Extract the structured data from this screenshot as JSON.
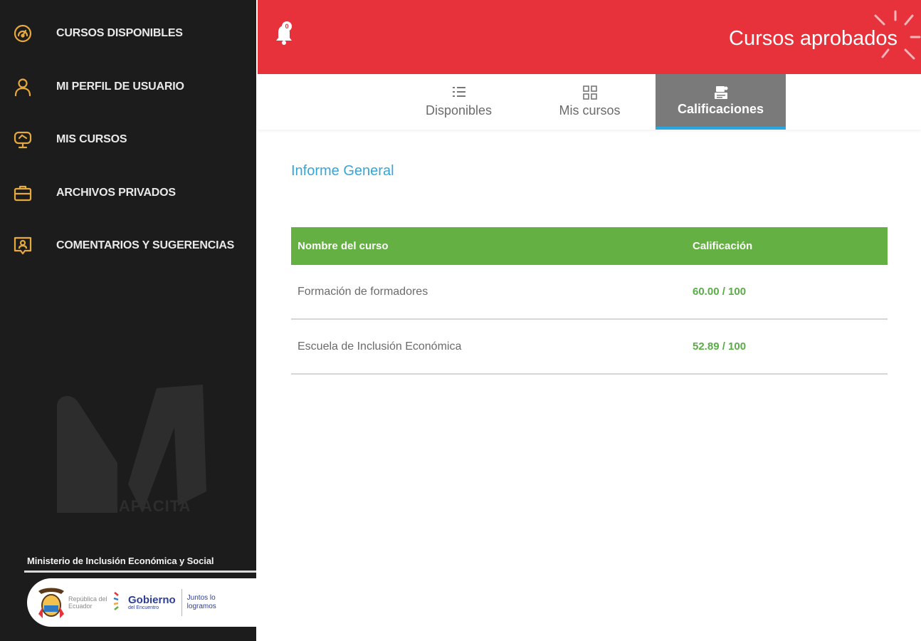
{
  "sidebar": {
    "items": [
      {
        "label": "CURSOS DISPONIBLES",
        "icon": "dashboard-gauge-icon"
      },
      {
        "label": "MI PERFIL DE USUARIO",
        "icon": "user-icon"
      },
      {
        "label": "MIS CURSOS",
        "icon": "monitor-icon"
      },
      {
        "label": "ARCHIVOS PRIVADOS",
        "icon": "briefcase-icon"
      },
      {
        "label": "COMENTARIOS Y SUGERENCIAS",
        "icon": "feedback-icon"
      }
    ],
    "watermark": {
      "logo": "mi-capacita-logo",
      "text": "CAPACITA"
    },
    "ministry": "Ministerio de Inclusión Económica y Social",
    "gov_card": {
      "republica": "República del Ecuador",
      "gobierno": "Gobierno",
      "gobierno_sub": "del Encuentro",
      "juntos": "Juntos lo logramos"
    }
  },
  "header": {
    "title": "Cursos aprobados",
    "notification_count": "0",
    "icon": "bell-icon"
  },
  "tabs": [
    {
      "label": "Disponibles",
      "icon": "list-icon",
      "active": false
    },
    {
      "label": "Mis cursos",
      "icon": "grid-icon",
      "active": false
    },
    {
      "label": "Calificaciones",
      "icon": "grades-icon",
      "active": true
    }
  ],
  "report": {
    "title": "Informe General",
    "columns": [
      "Nombre del curso",
      "Calificación"
    ],
    "rows": [
      {
        "course": "Formación de formadores",
        "grade": "60.00 / 100"
      },
      {
        "course": "Escuela de Inclusión Económica",
        "grade": "52.89 / 100"
      }
    ]
  },
  "colors": {
    "sidebar_bg": "#1c1c1c",
    "accent_gold": "#e6a93c",
    "header_red": "#e8323b",
    "table_green": "#64b042",
    "title_blue": "#36a5d8",
    "tab_active_bg": "#7a7a7a"
  }
}
